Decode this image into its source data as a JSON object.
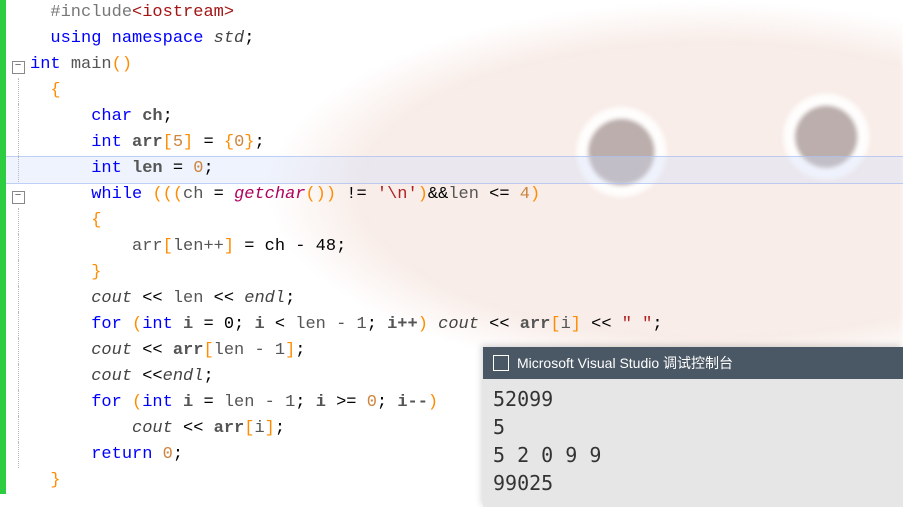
{
  "code": {
    "include_pp": "#include",
    "include_hdr": "<iostream>",
    "using_kw": "using",
    "namespace_kw": "namespace",
    "std": "std",
    "int_kw": "int",
    "main_fn": "main",
    "empty_parens": "()",
    "open_brace": "{",
    "close_brace": "}",
    "char_kw": "char",
    "ch_var": "ch",
    "semi": ";",
    "arr_var": "arr",
    "arr_size": "5",
    "eq": " = ",
    "zero": "0",
    "len_var": "len",
    "len_init": "0",
    "while_kw": "while",
    "getchar": "getchar",
    "neq": " != ",
    "newline_lit": "'\\n'",
    "andand": "&&",
    "le": " <= ",
    "four": "4",
    "arr_assign_rhs": " = ch - 48;",
    "lenpp": "len++",
    "cout": "cout",
    "lshift": " << ",
    "endl": "endl",
    "for_kw": "for",
    "i_var": "i",
    "i_init0": " = 0; ",
    "lt": " < ",
    "lenm1": "len - 1",
    "ipp": "i++",
    "space_lit": "\" \"",
    "ge": " >= ",
    "imm": "i--",
    "return_kw": "return"
  },
  "console": {
    "title": "Microsoft Visual Studio 调试控制台",
    "lines": [
      "52099",
      "5",
      "5 2 0 9 9",
      "99025"
    ]
  }
}
